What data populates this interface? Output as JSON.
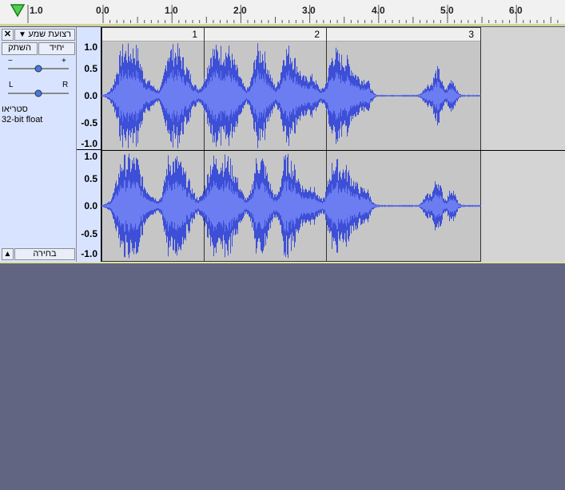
{
  "ruler": {
    "play_head_label": "1.0",
    "ticks": [
      "0.0",
      "1.0",
      "2.0",
      "3.0",
      "4.0",
      "5.0",
      "6.0"
    ]
  },
  "track": {
    "name": "רצועת שמע",
    "close_glyph": "✕",
    "menu_arrow": "▼",
    "mute_label": "השתק",
    "solo_label": "יחיד",
    "gain_minus": "−",
    "gain_plus": "+",
    "pan_left": "L",
    "pan_right": "R",
    "info_line1": "סטריאו",
    "info_line2": "32-bit float",
    "collapse_glyph": "▲",
    "select_label": "בחירה",
    "gain_level": 0.5,
    "pan_level": 0.5
  },
  "vertical_ruler": {
    "upper": [
      "1.0",
      "0.5",
      "0.0",
      "-0.5",
      "-1.0"
    ],
    "lower": [
      "1.0",
      "0.5",
      "0.0",
      "-0.5",
      "-1.0"
    ]
  },
  "clips": [
    {
      "name": "1"
    },
    {
      "name": "2"
    },
    {
      "name": "3"
    }
  ],
  "colors": {
    "waveform": "#3d4fd6",
    "waveform_rms": "#6b7df0",
    "background": "#626581",
    "track_panel": "#d8e4ff"
  }
}
